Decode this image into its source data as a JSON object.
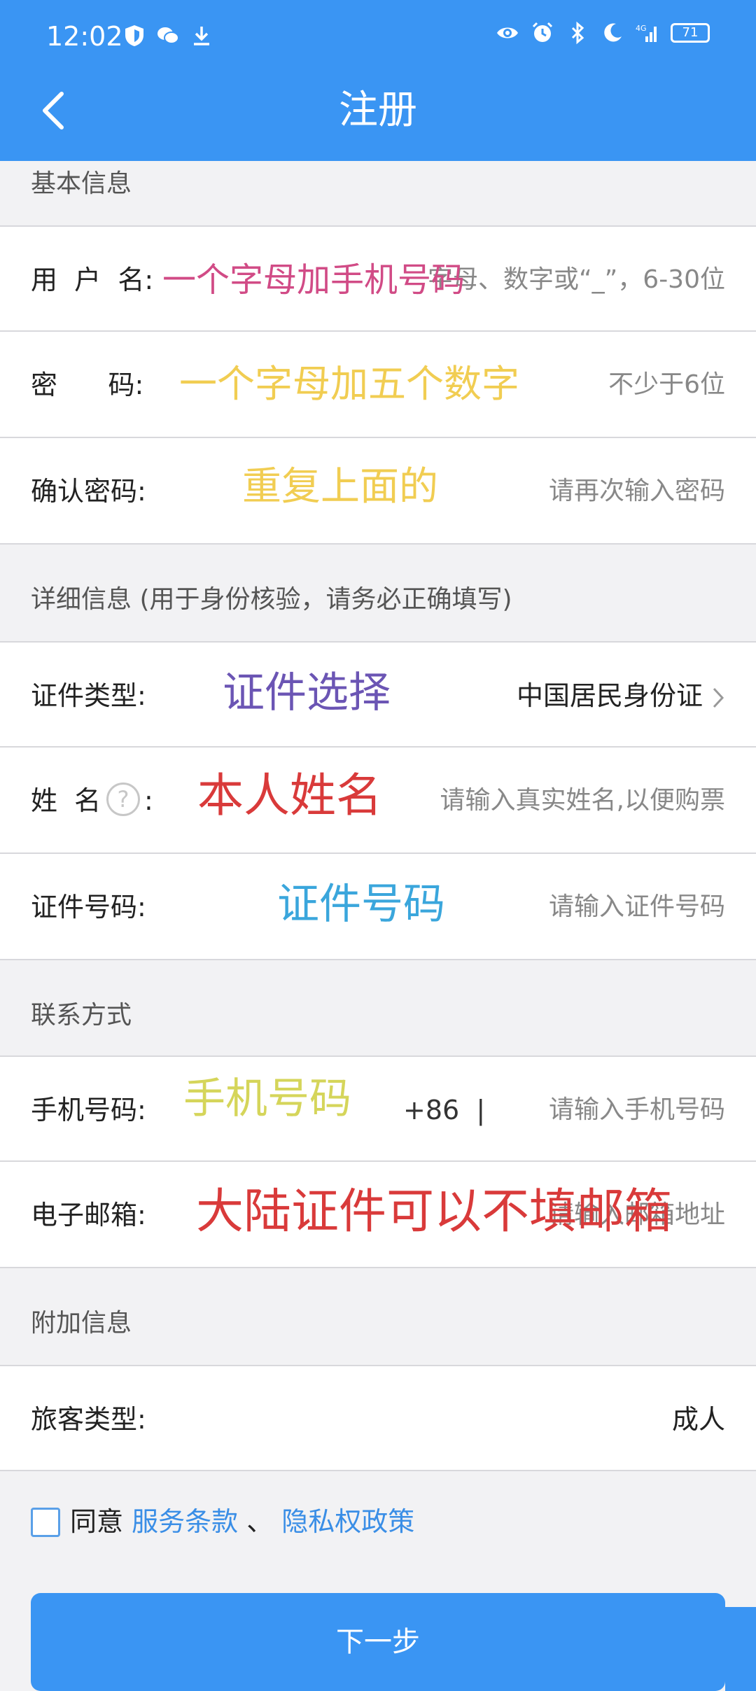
{
  "status_bar": {
    "time": "12:02",
    "battery": "71",
    "left_icons": [
      "shield-icon",
      "wechat-icon",
      "download-icon"
    ],
    "right_icons": [
      "eye-icon",
      "alarm-icon",
      "bluetooth-icon",
      "moon-icon",
      "signal-icon",
      "battery-icon"
    ],
    "network": "4G"
  },
  "header": {
    "title": "注册"
  },
  "sections": {
    "basic": "基本信息",
    "detail": "详细信息 (用于身份核验，请务必正确填写)",
    "contact": "联系方式",
    "extra": "附加信息"
  },
  "fields": {
    "username": {
      "label": "用  户  名:",
      "placeholder": "字母、数字或“_”，6-30位",
      "annotation": "一个字母加手机号码"
    },
    "password": {
      "label": "密      码:",
      "placeholder": "不少于6位",
      "annotation": "一个字母加五个数字"
    },
    "confirm": {
      "label": "确认密码:",
      "placeholder": "请再次输入密码",
      "annotation": "重复上面的"
    },
    "id_type": {
      "label": "证件类型:",
      "value": "中国居民身份证",
      "annotation": "证件选择"
    },
    "name": {
      "label": "姓  名",
      "label_suffix": ":",
      "placeholder": "请输入真实姓名,以便购票",
      "annotation": "本人姓名",
      "help": "?"
    },
    "id_number": {
      "label": "证件号码:",
      "placeholder": "请输入证件号码",
      "annotation": "证件号码"
    },
    "phone": {
      "label": "手机号码:",
      "prefix": "+86  |",
      "placeholder": "请输入手机号码",
      "annotation": "手机号码"
    },
    "email": {
      "label": "电子邮箱:",
      "placeholder": "请输入邮箱地址",
      "annotation": "大陆证件可以不填邮箱"
    },
    "passenger_type": {
      "label": "旅客类型:",
      "value": "成人"
    }
  },
  "agreement": {
    "prefix": "同意 ",
    "terms": "服务条款",
    "sep": " 、 ",
    "privacy": "隐私权政策"
  },
  "next_button": "下一步",
  "colors": {
    "accent": "#3a95f3",
    "annotation_pink": "#d14b86",
    "annotation_yellow": "#f1cd52",
    "annotation_purple": "#6b55b4",
    "annotation_red": "#d93a3a",
    "annotation_cyan": "#3aa6dc",
    "annotation_lime": "#d5d55a"
  }
}
